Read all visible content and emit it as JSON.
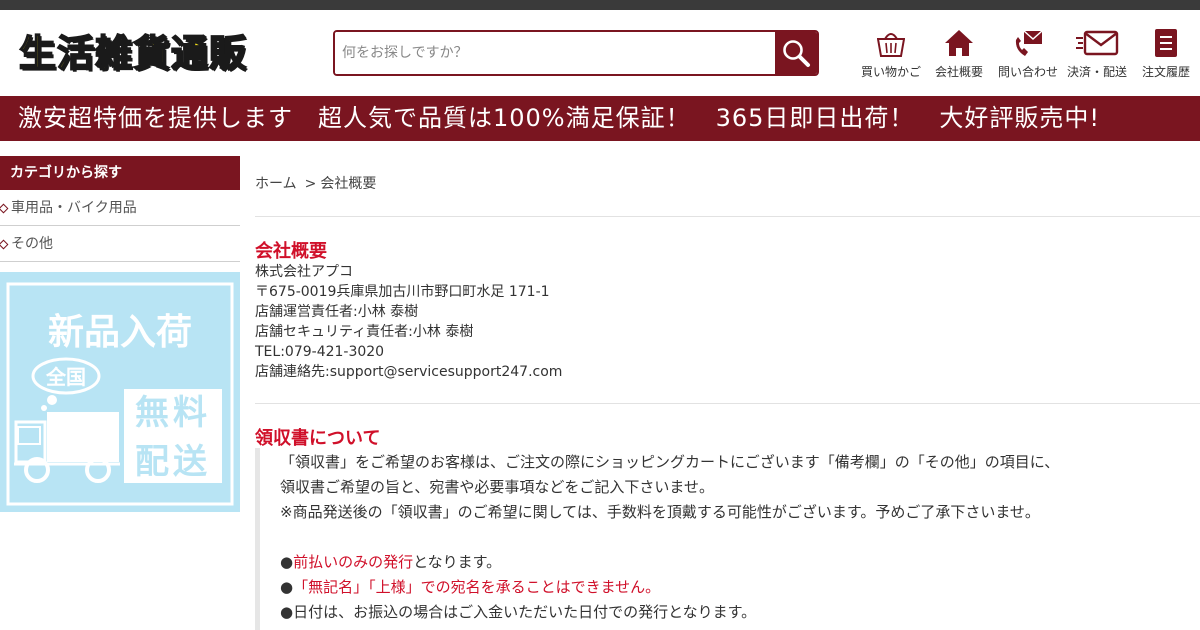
{
  "header": {
    "logo_text": "生活雑貨通販",
    "search_placeholder": "何をお探しですか？",
    "nav": [
      {
        "label": "買い物かご",
        "icon": "basket-icon"
      },
      {
        "label": "会社概要",
        "icon": "house-icon"
      },
      {
        "label": "問い合わせ",
        "icon": "phone-mail-icon"
      },
      {
        "label": "決済・配送",
        "icon": "delivery-mail-icon"
      },
      {
        "label": "注文履歴",
        "icon": "document-list-icon"
      }
    ]
  },
  "banner": {
    "text": "激安超特価を提供します　超人気で品質は100%満足保証！　365日即日出荷！　大好評販売中!"
  },
  "sidebar": {
    "heading": "カテゴリから探す",
    "items": [
      {
        "label": "車用品・バイク用品"
      },
      {
        "label": "その他"
      }
    ],
    "promo": {
      "line1": "新品入荷",
      "badge": "全国",
      "right_top": "無料",
      "right_bottom": "配送"
    }
  },
  "breadcrumb": {
    "home": "ホーム",
    "separator": ">",
    "current": "会社概要"
  },
  "company": {
    "title": "会社概要",
    "name": "株式会社アプコ",
    "address": "〒675-0019兵庫県加古川市野口町水足 171-1",
    "manager": "店舗運営責任者:小林 泰樹",
    "security": "店舗セキュリティ責任者:小林 泰樹",
    "tel": "TEL:079-421-3020",
    "contact": "店舗連絡先:support@servicesupport247.com"
  },
  "receipt": {
    "title": "領収書について",
    "line1": "「領収書」をご希望のお客様は、ご注文の際にショッピングカートにございます「備考欄」の「その他」の項目に、",
    "line2": "領収書ご希望の旨と、宛書や必要事項などをご記入下さいませ。",
    "line3": "※商品発送後の「領収書」のご希望に関しては、手数料を頂戴する可能性がございます。予めご了承下さいませ。",
    "bullet1_mark": "●",
    "bullet1_red": "前払いのみの発行",
    "bullet1_rest": "となります。",
    "bullet2_mark": "●",
    "bullet2_red": "「無記名」「上様」での宛名を承ることはできません。",
    "bullet3": "●日付は、お振込の場合はご入金いただいた日付での発行となります。"
  },
  "colors": {
    "brand": "#7a1520",
    "accent_red": "#d0102a",
    "logo_yellow": "#f5e21a",
    "promo_bg": "#b8e4f4"
  }
}
